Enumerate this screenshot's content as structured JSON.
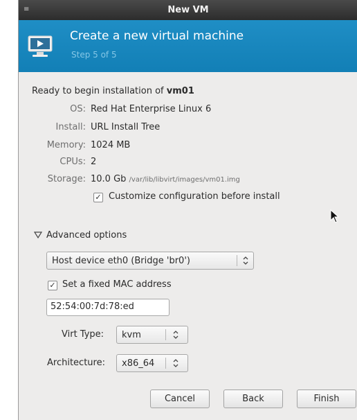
{
  "window": {
    "title": "New VM"
  },
  "header": {
    "title": "Create a new virtual machine",
    "step": "Step 5 of 5"
  },
  "summary": {
    "ready_prefix": "Ready to begin installation of",
    "vm_name": "vm01",
    "rows": [
      {
        "label": "OS:",
        "value": "Red Hat Enterprise Linux 6"
      },
      {
        "label": "Install:",
        "value": "URL Install Tree"
      },
      {
        "label": "Memory:",
        "value": "1024 MB"
      },
      {
        "label": "CPUs:",
        "value": "2"
      },
      {
        "label": "Storage:",
        "value": "10.0 Gb",
        "path": "/var/lib/libvirt/images/vm01.img"
      }
    ]
  },
  "customize": {
    "label": "Customize configuration before install",
    "checked": true
  },
  "advanced": {
    "label": "Advanced options",
    "expanded": true,
    "network": "Host device eth0 (Bridge 'br0')",
    "fixed_mac": {
      "label": "Set a fixed MAC address",
      "checked": true
    },
    "mac_value": "52:54:00:7d:78:ed",
    "virt_type": {
      "label": "Virt Type:",
      "value": "kvm"
    },
    "architecture": {
      "label": "Architecture:",
      "value": "x86_64"
    }
  },
  "buttons": {
    "cancel": "Cancel",
    "back": "Back",
    "finish": "Finish"
  },
  "icons": {
    "window_menu": "window-menu-icon",
    "vm": "virtual-machine-icon",
    "expander": "expander-triangle-icon",
    "spin": "up-down-arrows-icon",
    "pointer": "mouse-pointer-icon"
  },
  "colors": {
    "banner": "#1a88c0",
    "title_bar": "#3a3a3a",
    "window_bg": "#edeceb"
  }
}
